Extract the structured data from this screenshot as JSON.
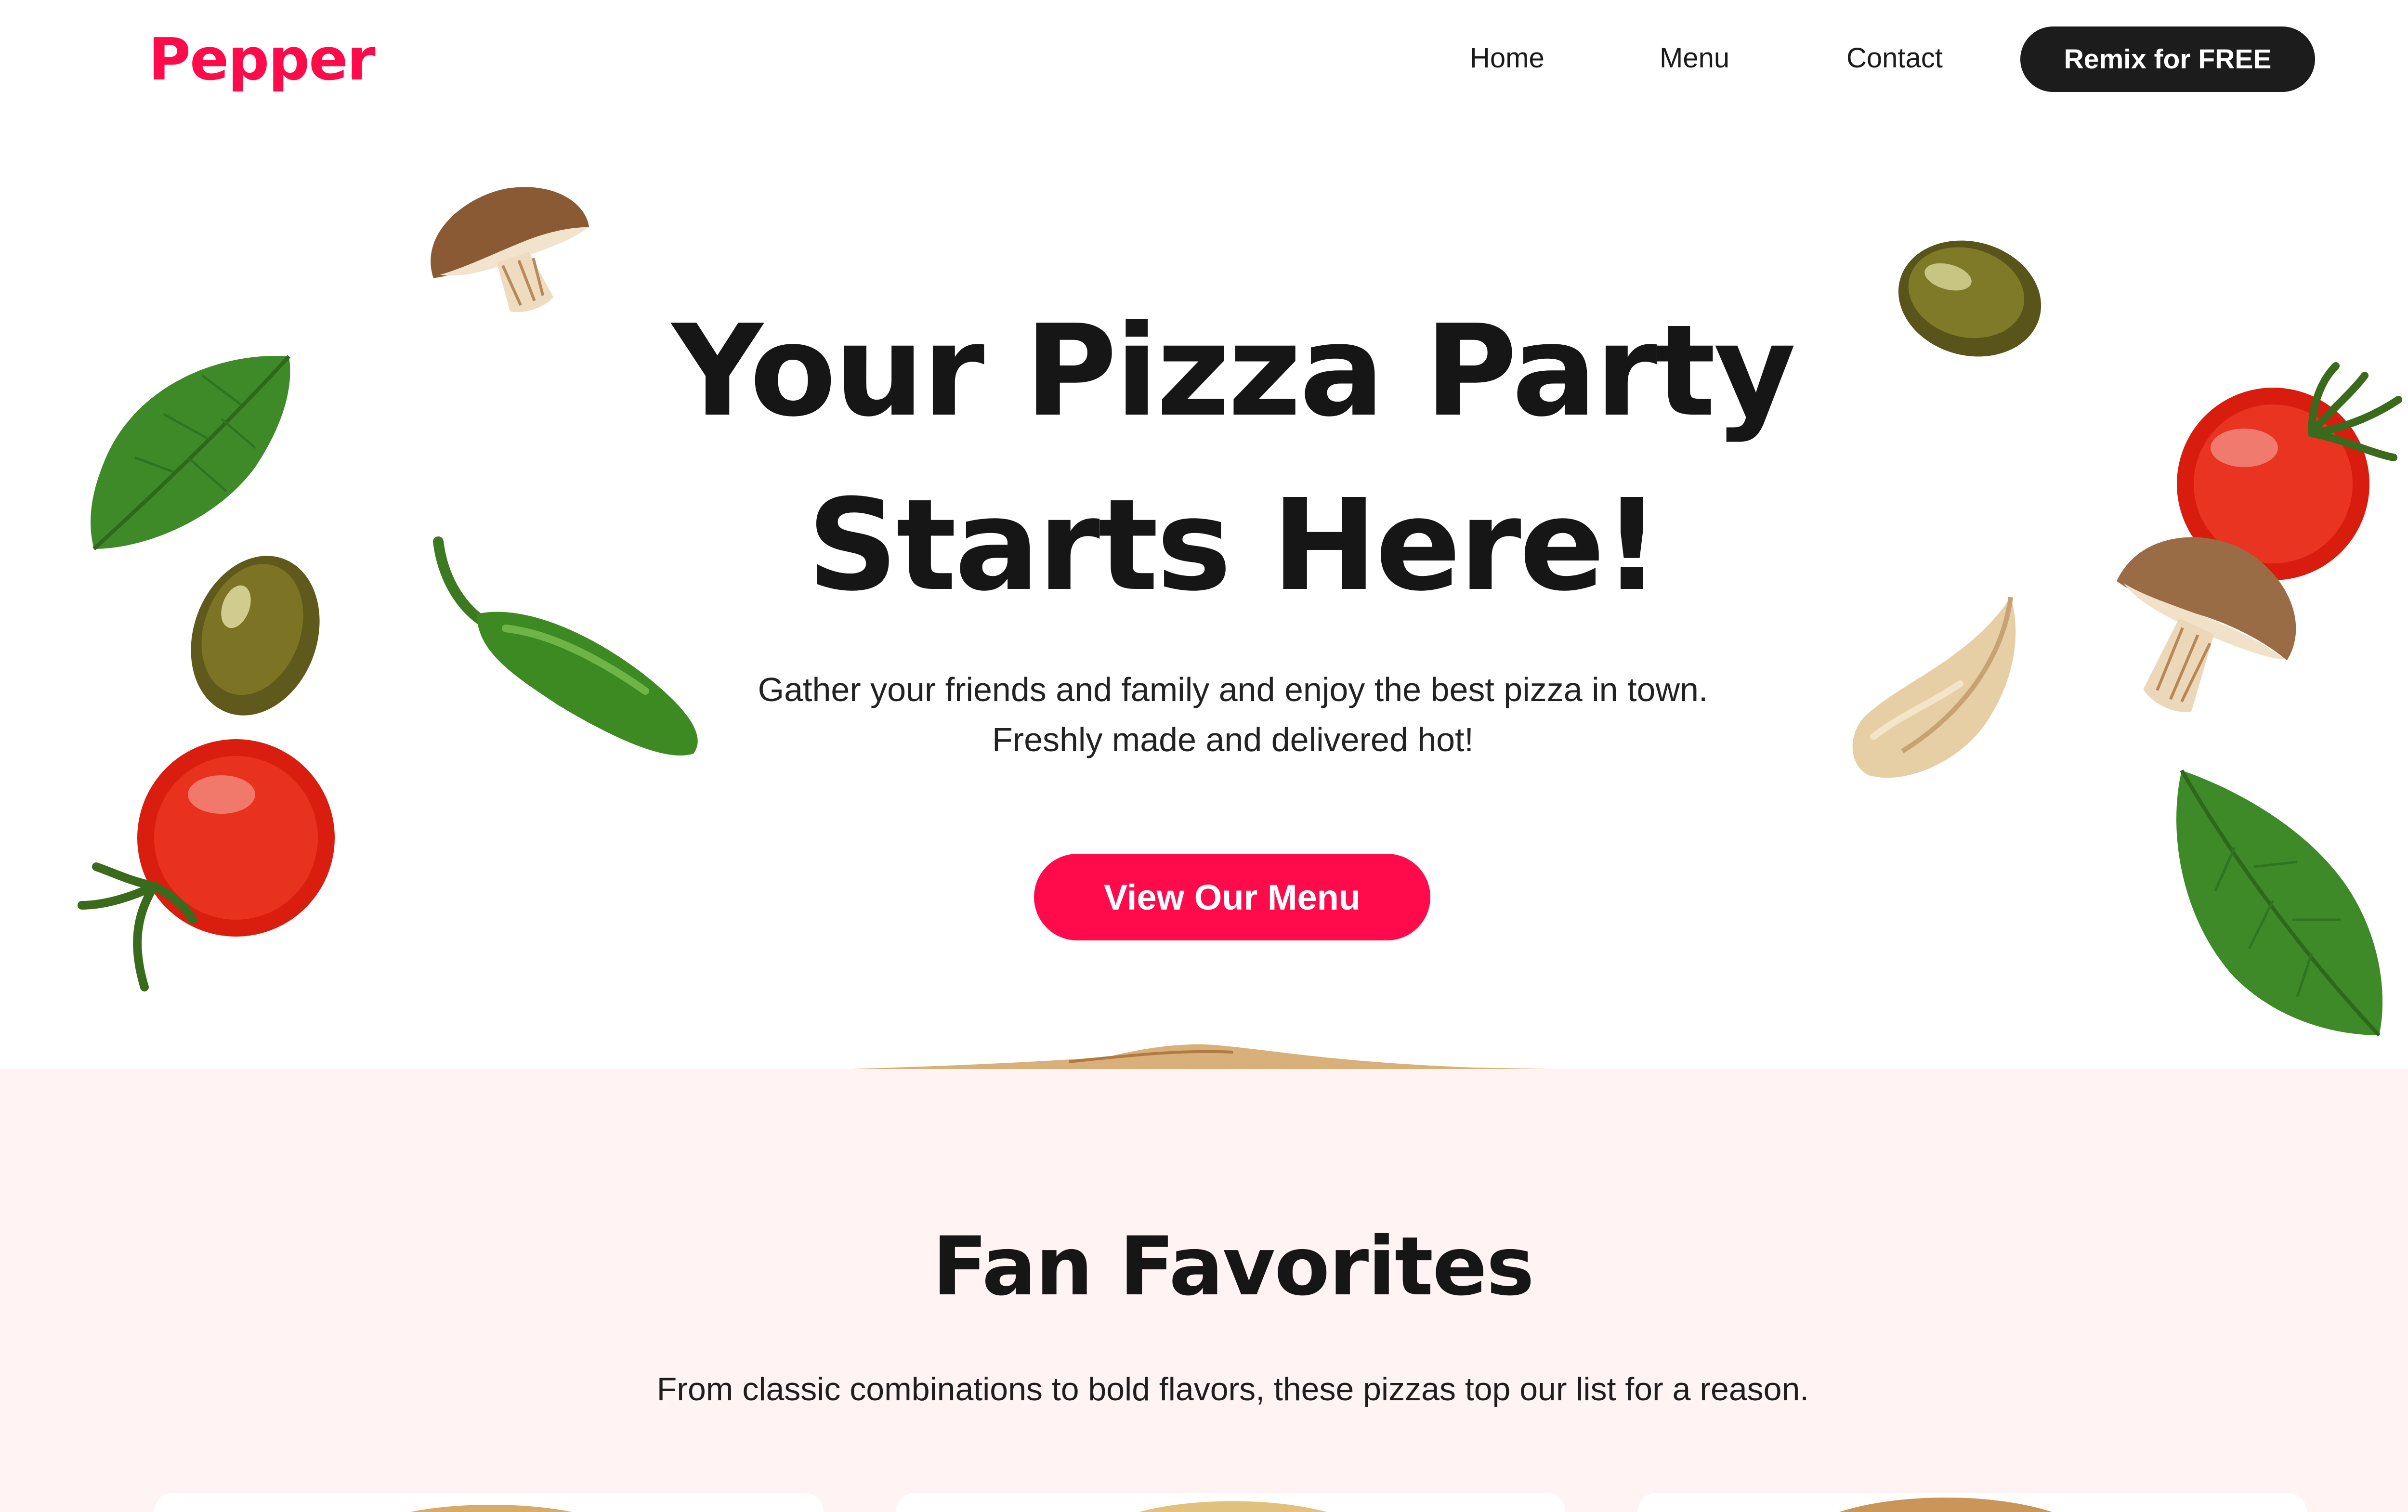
{
  "brand": {
    "logo_text": "Pepper",
    "accent_color": "#ff0b4c",
    "dark_color": "#1c1c1c",
    "section_bg": "#fff3f4"
  },
  "nav": {
    "links": [
      {
        "label": "Home"
      },
      {
        "label": "Menu"
      },
      {
        "label": "Contact"
      }
    ],
    "cta_label": "Remix for FREE"
  },
  "hero": {
    "title": "Your Pizza Party\nStarts Here!",
    "subtitle": "Gather your friends and family and enjoy the best pizza in town.\nFreshly made and delivered hot!",
    "cta_label": "View Our Menu"
  },
  "decorations": [
    {
      "icon": "mushroom-icon"
    },
    {
      "icon": "basil-leaf-icon"
    },
    {
      "icon": "olive-icon"
    },
    {
      "icon": "cherry-tomato-icon"
    },
    {
      "icon": "jalapeno-icon"
    },
    {
      "icon": "olive-icon"
    },
    {
      "icon": "cherry-tomato-icon"
    },
    {
      "icon": "mushroom-icon"
    },
    {
      "icon": "garlic-clove-icon"
    },
    {
      "icon": "basil-leaf-icon"
    }
  ],
  "favorites": {
    "title": "Fan Favorites",
    "subtitle": "From classic combinations to bold flavors, these pizzas top our list for a reason."
  }
}
